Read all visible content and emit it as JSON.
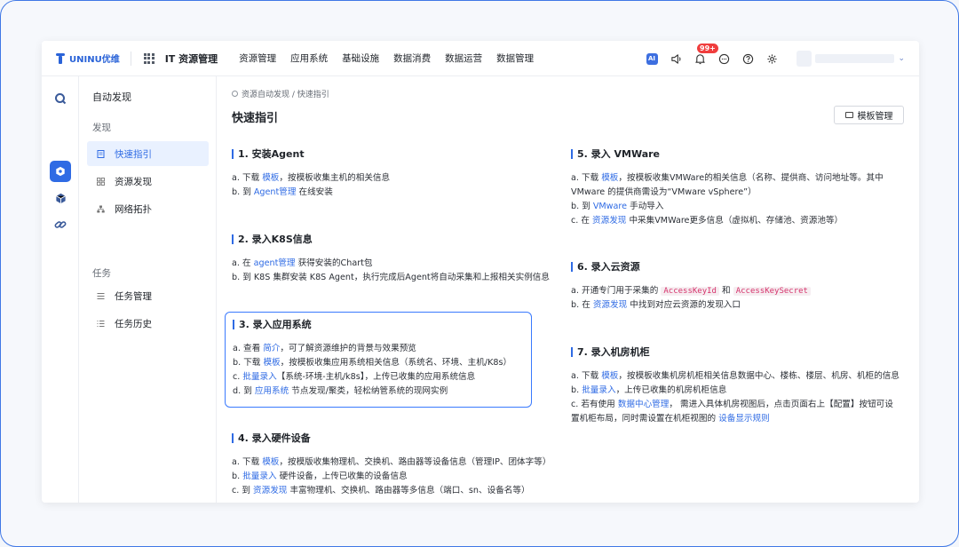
{
  "header": {
    "logo_text": "UNINU优维",
    "app_title": "IT 资源管理",
    "nav": [
      "资源管理",
      "应用系统",
      "基础设施",
      "数据消费",
      "数据运营",
      "数据管理"
    ],
    "ai_label": "AI",
    "notification_count": "99+"
  },
  "sidebar": {
    "title": "自动发现",
    "groups": [
      {
        "label": "发现",
        "items": [
          {
            "label": "快速指引",
            "icon": "document-icon",
            "active": true
          },
          {
            "label": "资源发现",
            "icon": "grid-icon",
            "active": false
          },
          {
            "label": "网络拓扑",
            "icon": "topology-icon",
            "active": false
          }
        ]
      },
      {
        "label": "任务",
        "items": [
          {
            "label": "任务管理",
            "icon": "list-icon",
            "active": false
          },
          {
            "label": "任务历史",
            "icon": "history-list-icon",
            "active": false
          }
        ]
      }
    ]
  },
  "main": {
    "breadcrumb": "资源自动发现 / 快速指引",
    "title": "快速指引",
    "template_button": "模板管理",
    "sections": {
      "s1": {
        "title": "1. 安装Agent",
        "a": {
          "t1": "a. 下载 ",
          "l1": "模板",
          "t2": "，按模板收集主机的相关信息"
        },
        "b": {
          "t1": "b. 到 ",
          "l1": "Agent管理",
          "t2": " 在线安装"
        }
      },
      "s2": {
        "title": "2. 录入K8S信息",
        "a": {
          "t1": "a. 在 ",
          "l1": "agent管理",
          "t2": " 获得安装的Chart包"
        },
        "b": {
          "t1": "b. 到 K8S 集群安装 K8S Agent，执行完成后Agent将自动采集和上报相关实例信息"
        }
      },
      "s3": {
        "title": "3. 录入应用系统",
        "a": {
          "t1": "a. 查看 ",
          "l1": "简介",
          "t2": "，可了解资源维护的背景与效果预览"
        },
        "b": {
          "t1": "b. 下载 ",
          "l1": "模板",
          "t2": "，按模板收集应用系统相关信息（系统名、环境、主机/K8s）"
        },
        "c": {
          "t1": "c. ",
          "l1": "批量录入",
          "t2": "【系统-环境-主机/k8s】，上传已收集的应用系统信息"
        },
        "d": {
          "t1": "d. 到 ",
          "l1": "应用系统",
          "t2": " 节点发现/聚类，轻松纳管系统的现网实例"
        }
      },
      "s4": {
        "title": "4. 录入硬件设备",
        "a": {
          "t1": "a. 下载 ",
          "l1": "模板",
          "t2": "，按模版收集物理机、交换机、路由器等设备信息（管理IP、团体字等）"
        },
        "b": {
          "t1": "b. ",
          "l1": "批量录入",
          "t2": " 硬件设备，上传已收集的设备信息"
        },
        "c": {
          "t1": "c. 到 ",
          "l1": "资源发现",
          "t2": " 丰富物理机、交换机、路由器等多信息（端口、sn、设备名等）"
        }
      },
      "s5": {
        "title": "5. 录入 VMWare",
        "a": {
          "t1": "a. 下载 ",
          "l1": "模板",
          "t2": "，按模板收集VMWare的相关信息（名称、提供商、访问地址等。其中 VMware 的提供商需设为“VMware vSphere”）"
        },
        "b": {
          "t1": "b. 到 ",
          "l1": "VMware",
          "t2": " 手动导入"
        },
        "c": {
          "t1": "c. 在 ",
          "l1": "资源发现",
          "t2": " 中采集VMWare更多信息（虚拟机、存储池、资源池等）"
        }
      },
      "s6": {
        "title": "6. 录入云资源",
        "a": {
          "t1": "a. 开通专门用于采集的 ",
          "c1": "AccessKeyId",
          "t2": " 和 ",
          "c2": "AccessKeySecret"
        },
        "b": {
          "t1": "b. 在 ",
          "l1": "资源发现",
          "t2": " 中找到对应云资源的发现入口"
        }
      },
      "s7": {
        "title": "7. 录入机房机柜",
        "a": {
          "t1": "a. 下载 ",
          "l1": "模板",
          "t2": "，按模板收集机房机柜相关信息数据中心、楼栋、楼层、机房、机柜的信息"
        },
        "b": {
          "t1": "b. ",
          "l1": "批量录入",
          "t2": "，上传已收集的机房机柜信息"
        },
        "c": {
          "t1": "c. 若有使用 ",
          "l1": "数据中心管理",
          "t2": "， 需进入具体机房视图后，点击页面右上【配置】按钮可设置机柜布局，同时需设置在机柜视图的 ",
          "l2": "设备显示规则"
        }
      }
    }
  },
  "colors": {
    "accent": "#2f6be4",
    "badge": "#f03d3d",
    "code": "#d6336c"
  }
}
